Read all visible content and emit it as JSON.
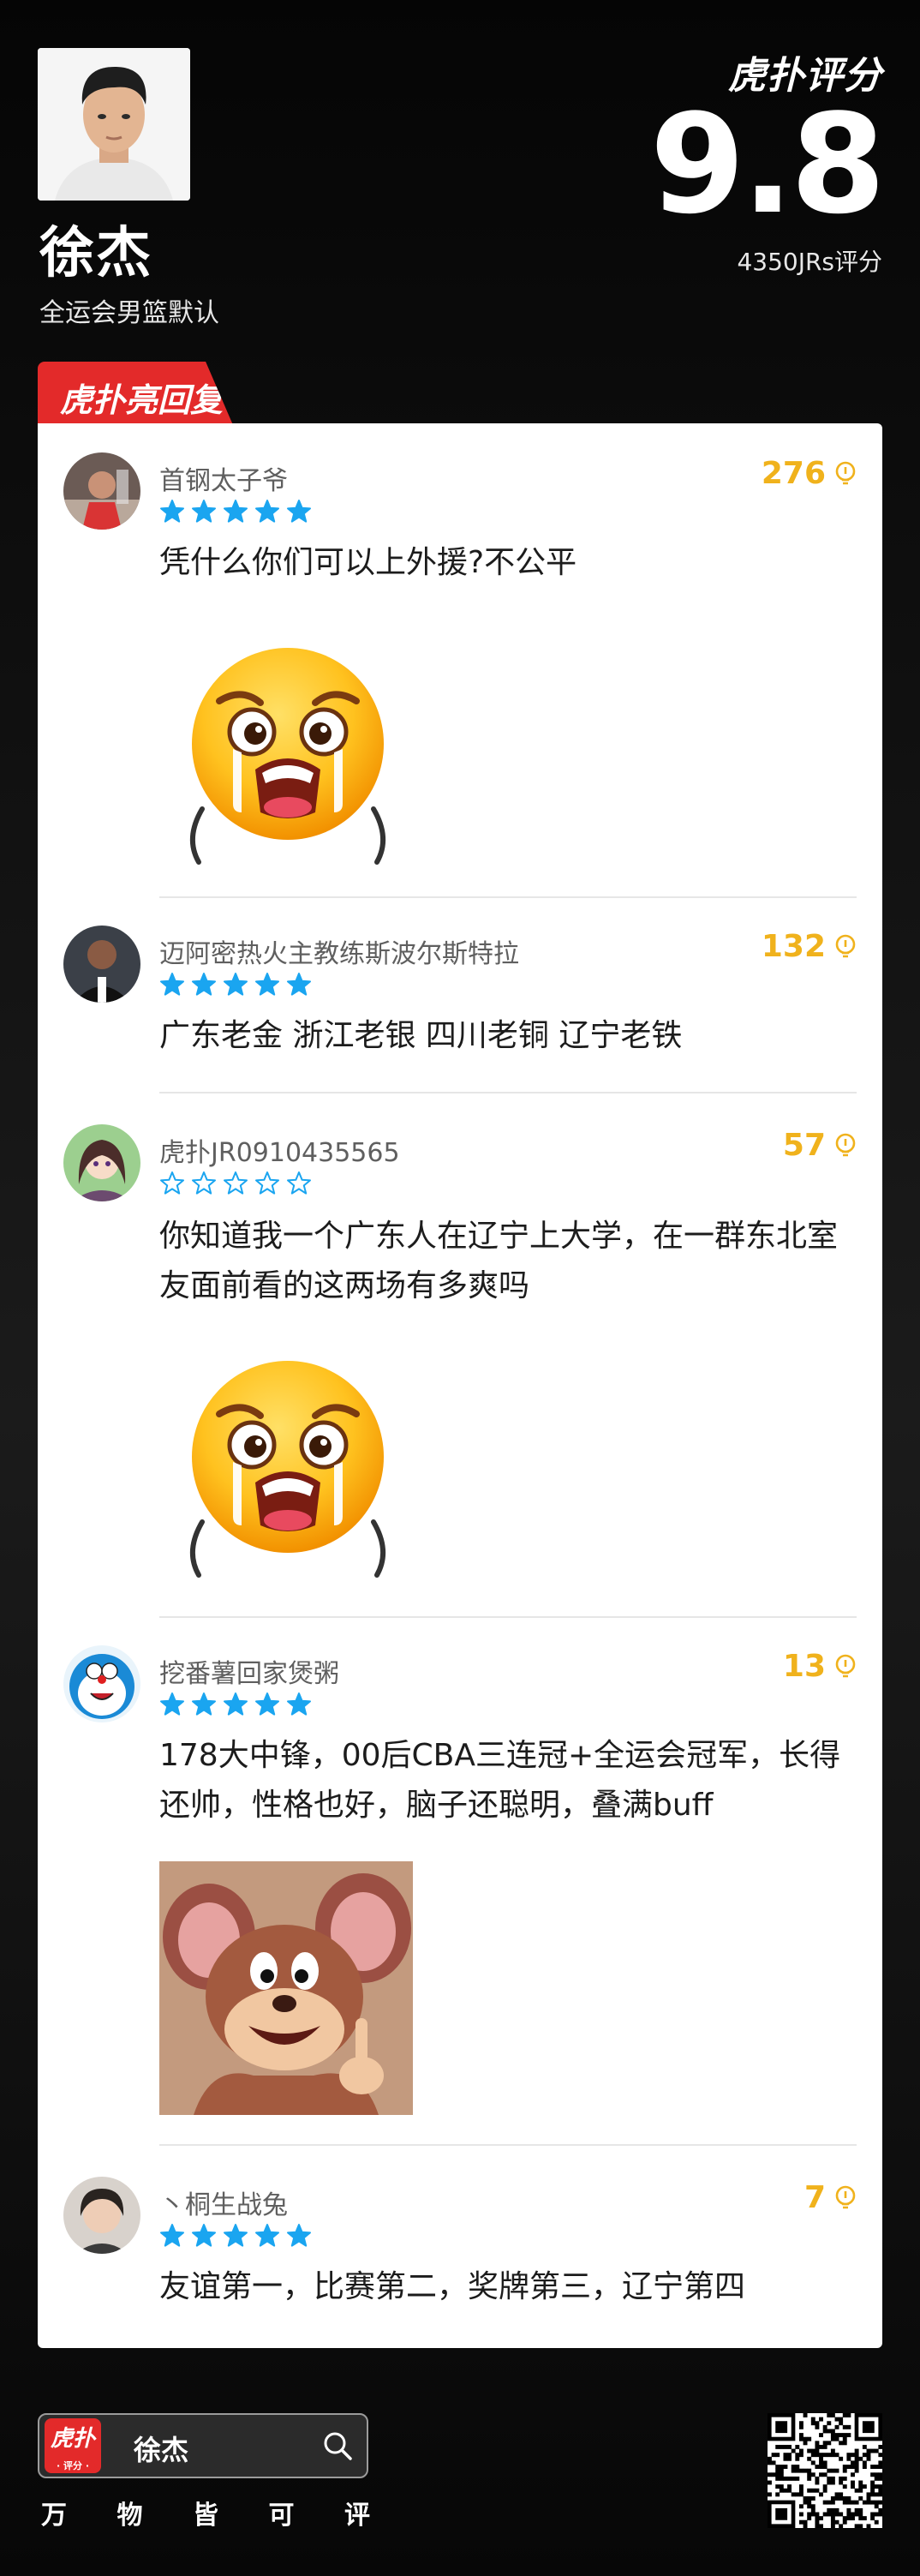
{
  "player": {
    "name": "徐杰",
    "subtitle": "全运会男篮默认"
  },
  "brand": {
    "logo_text": "虎扑评分",
    "score": "9.8",
    "rating_count": "4350JRs评分"
  },
  "section_tag": "虎扑亮回复",
  "colors": {
    "accent_red": "#e32a2a",
    "likes_gold": "#f0b21c",
    "star_blue": "#1aa5f0"
  },
  "comments": [
    {
      "username": "首钢太子爷",
      "likes": "276",
      "stars": 5,
      "text": "凭什么你们可以上外援?不公平",
      "attachment": "crying-emoji"
    },
    {
      "username": "迈阿密热火主教练斯波尔斯特拉",
      "likes": "132",
      "stars": 5,
      "text": "广东老金 浙江老银 四川老铜 辽宁老铁",
      "attachment": ""
    },
    {
      "username": "虎扑JR0910435565",
      "likes": "57",
      "stars": 0,
      "text": "你知道我一个广东人在辽宁上大学，在一群东北室友面前看的这两场有多爽吗",
      "attachment": "crying-emoji"
    },
    {
      "username": "挖番薯回家煲粥",
      "likes": "13",
      "stars": 5,
      "text": "178大中锋，00后CBA三连冠+全运会冠军，长得还帅，性格也好，脑子还聪明，叠满buff",
      "attachment": "jerry-meme"
    },
    {
      "username": "丶桐生战兔",
      "likes": "7",
      "stars": 5,
      "text": "友谊第一，比赛第二，奖牌第三，辽宁第四",
      "attachment": ""
    }
  ],
  "footer": {
    "app_icon_text": "虎扑",
    "app_icon_sub": "· 评分 ·",
    "search_value": "徐杰",
    "slogan": [
      "万",
      "物",
      "皆",
      "可",
      "评"
    ]
  }
}
